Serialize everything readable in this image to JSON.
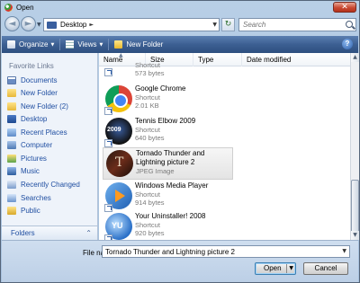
{
  "window": {
    "title": "Open",
    "close_label": "✕"
  },
  "navigation": {
    "back_symbol": "◄",
    "forward_symbol": "►",
    "recent_dropdown": "▼",
    "breadcrumb": "Desktop",
    "breadcrumb_separator": "►",
    "address_dropdown": "▼",
    "refresh_symbol": "↻"
  },
  "search": {
    "placeholder": "Search",
    "value": ""
  },
  "toolbar": {
    "organize": "Organize",
    "views": "Views",
    "new_folder": "New Folder",
    "dropdown": "▼",
    "help": "?"
  },
  "sidebar": {
    "heading": "Favorite Links",
    "items": [
      {
        "label": "Documents",
        "icon": "documents-icon"
      },
      {
        "label": "New Folder",
        "icon": "folder-icon"
      },
      {
        "label": "New Folder (2)",
        "icon": "folder-icon"
      },
      {
        "label": "Desktop",
        "icon": "desktop-icon"
      },
      {
        "label": "Recent Places",
        "icon": "recent-places-icon"
      },
      {
        "label": "Computer",
        "icon": "computer-icon"
      },
      {
        "label": "Pictures",
        "icon": "pictures-icon"
      },
      {
        "label": "Music",
        "icon": "music-icon"
      },
      {
        "label": "Recently Changed",
        "icon": "recently-changed-icon"
      },
      {
        "label": "Searches",
        "icon": "searches-icon"
      },
      {
        "label": "Public",
        "icon": "public-icon"
      }
    ],
    "folders_label": "Folders",
    "folders_chevron": "⌃"
  },
  "columns": {
    "name": "Name",
    "size": "Size",
    "type": "Type",
    "date": "Date modified",
    "sort_arrow": "▲"
  },
  "files": [
    {
      "name": "",
      "type": "Shortcut",
      "size": "573 bytes",
      "icon": "shortcut-icon"
    },
    {
      "name": "Google Chrome",
      "type": "Shortcut",
      "size": "2.01 KB",
      "icon": "chrome-icon"
    },
    {
      "name": "Tennis Elbow 2009",
      "type": "Shortcut",
      "size": "640 bytes",
      "icon": "tennis-elbow-icon"
    },
    {
      "name": "Tornado Thunder and Lightning picture 2",
      "type": "JPEG Image",
      "size": "",
      "icon": "jpeg-thumbnail-icon"
    },
    {
      "name": "Windows Media Player",
      "type": "Shortcut",
      "size": "914 bytes",
      "icon": "media-player-icon"
    },
    {
      "name": "Your Uninstaller! 2008",
      "type": "Shortcut",
      "size": "920 bytes",
      "icon": "uninstaller-icon"
    }
  ],
  "scrollbar": {
    "up": "▲",
    "down": "▼",
    "position": 0.78
  },
  "bottom": {
    "file_name_label": "File name:",
    "file_name_value": "Tornado Thunder and Lightning picture 2",
    "file_name_dropdown": "▼",
    "open_label": "Open",
    "open_dropdown": "▼",
    "cancel_label": "Cancel"
  },
  "colors": {
    "toolbar": "#3c5f92",
    "link": "#1f4ea1",
    "close": "#c94a33"
  }
}
